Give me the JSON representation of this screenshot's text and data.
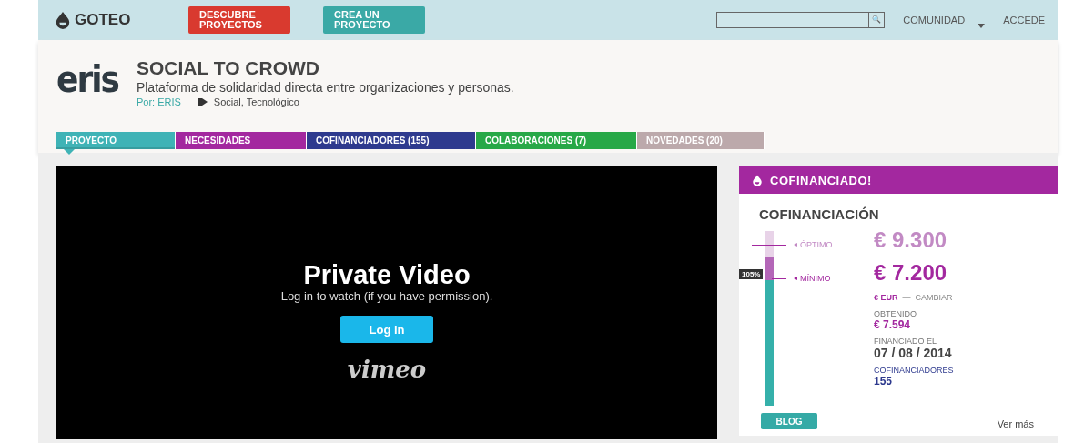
{
  "header": {
    "logo": "GOTEO",
    "buttons": [
      {
        "label": "DESCUBRE PROYECTOS",
        "color": "#d93a2f"
      },
      {
        "label": "CREA UN PROYECTO",
        "color": "#3aa9a6"
      }
    ],
    "search": {
      "button": "🔍"
    },
    "nav": [
      "COMUNIDAD",
      "ACCEDE"
    ]
  },
  "project": {
    "logo": "eris",
    "title": "SOCIAL TO CROWD",
    "subtitle": "Plataforma de solidaridad directa entre organizaciones y personas.",
    "author": "Por: ERIS",
    "categories": "Social, Tecnológico"
  },
  "tabs": [
    {
      "label": "PROYECTO",
      "color": "#3fb3b6",
      "selected": true
    },
    {
      "label": "NECESIDADES",
      "color": "#a3289f",
      "selected": false
    },
    {
      "label": "COFINANCIADORES (155)",
      "color": "#2e3a8e",
      "selected": false
    },
    {
      "label": "COLABORACIONES  (7)",
      "color": "#27a847",
      "selected": false
    },
    {
      "label": "NOVEDADES  (20)",
      "color": "#bca9ab",
      "selected": false
    }
  ],
  "video": {
    "title": "Private Video",
    "message": "Log in to watch (if you have permission).",
    "button": "Log in",
    "brand": "vimeo"
  },
  "card": {
    "banner": "COFINANCIADO!",
    "heading": "COFINANCIACIÓN",
    "gauge": {
      "level": 0.72,
      "percent": "105%"
    },
    "optimum_label": "ÓPTIMO",
    "optimum": "€ 9.300",
    "minimum_label": "MÍNIMO",
    "minimum": "€ 7.200",
    "currency": "€ EUR",
    "separator": "—",
    "change": "CAMBIAR",
    "obtained_label": "OBTENIDO",
    "obtained": "€ 7.594",
    "funded_label": "FINANCIADO EL",
    "funded_date": "07 / 08 / 2014",
    "backers_label": "COFINANCIADORES",
    "backers": "155",
    "blog": "BLOG",
    "more": "Ver más"
  }
}
